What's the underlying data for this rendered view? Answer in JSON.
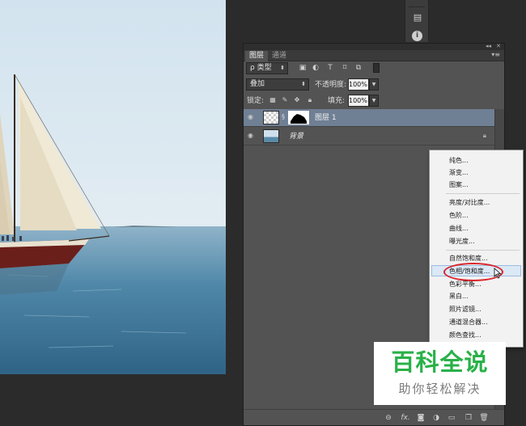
{
  "panel": {
    "tabs": [
      {
        "label": "图层"
      },
      {
        "label": "通道"
      }
    ],
    "filter": {
      "label": "ρ 类型"
    },
    "blend_mode": {
      "value": "叠加"
    },
    "opacity": {
      "label": "不透明度:",
      "value": "100%"
    },
    "lock": {
      "label": "锁定:"
    },
    "fill": {
      "label": "填充:",
      "value": "100%"
    },
    "layers": [
      {
        "name": "图层 1",
        "selected": true
      },
      {
        "name": "背景",
        "selected": false
      }
    ],
    "footer_fx": "fx."
  },
  "adjustment_menu": {
    "groups": [
      [
        "纯色...",
        "渐变...",
        "图案..."
      ],
      [
        "亮度/对比度...",
        "色阶...",
        "曲线...",
        "曝光度..."
      ],
      [
        "自然饱和度...",
        "色相/饱和度...",
        "色彩平衡...",
        "黑白...",
        "照片滤镜...",
        "通道混合器...",
        "颜色查找..."
      ]
    ],
    "highlighted": "色相/饱和度..."
  },
  "watermark": {
    "title": "百科全说",
    "subtitle": "助你轻松解决"
  },
  "colors": {
    "panel_bg": "#535353",
    "selected_layer": "#6f7f94",
    "menu_bg": "#f2f2f2",
    "highlight_ring": "#d9252b",
    "watermark_green": "#29b148"
  }
}
